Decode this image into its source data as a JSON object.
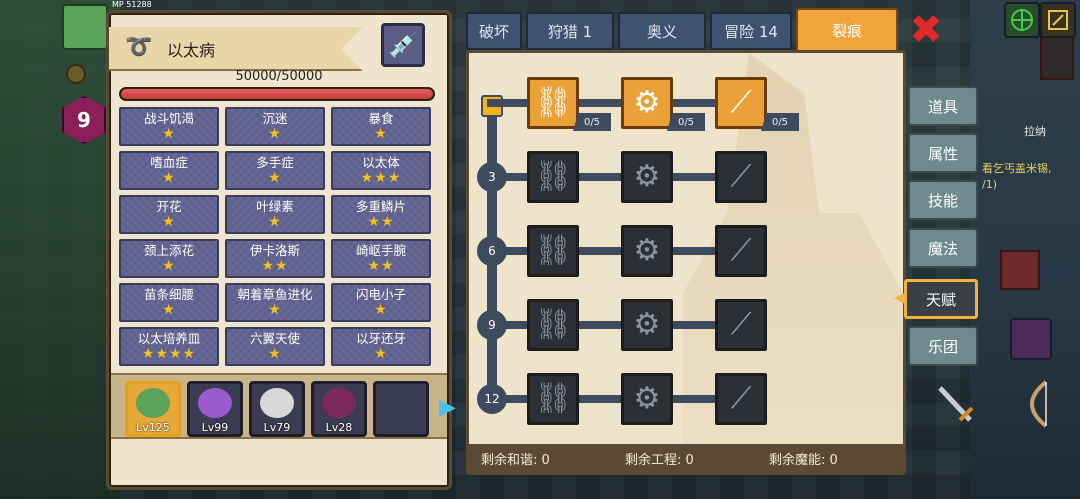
{
  "player": {
    "level": "9",
    "hp_mini": "MP 51288"
  },
  "left_panel": {
    "title": "以太病",
    "hp_text": "50000/50000",
    "hp_fraction": 1.0,
    "traits": [
      {
        "name": "战斗饥渴",
        "stars": 1
      },
      {
        "name": "沉迷",
        "stars": 1
      },
      {
        "name": "暴食",
        "stars": 1
      },
      {
        "name": "嗜血症",
        "stars": 1
      },
      {
        "name": "多手症",
        "stars": 1
      },
      {
        "name": "以太体",
        "stars": 3
      },
      {
        "name": "开花",
        "stars": 1
      },
      {
        "name": "叶绿素",
        "stars": 1
      },
      {
        "name": "多重鳞片",
        "stars": 2
      },
      {
        "name": "颈上添花",
        "stars": 1
      },
      {
        "name": "伊卡洛斯",
        "stars": 2
      },
      {
        "name": "崎岖手腕",
        "stars": 2
      },
      {
        "name": "苗条细腰",
        "stars": 1
      },
      {
        "name": "朝着章鱼进化",
        "stars": 1
      },
      {
        "name": "闪电小子",
        "stars": 1
      },
      {
        "name": "以太培养皿",
        "stars": 4
      },
      {
        "name": "六翼天使",
        "stars": 1
      },
      {
        "name": "以牙还牙",
        "stars": 1
      }
    ],
    "heroes": [
      {
        "level": "Lv125",
        "color": "#5aa35a",
        "selected": true
      },
      {
        "level": "Lv99",
        "color": "#9a5ad0",
        "selected": false
      },
      {
        "level": "Lv79",
        "color": "#d8d8d8",
        "selected": false
      },
      {
        "level": "Lv28",
        "color": "#7a2a5a",
        "selected": false
      },
      {
        "level": "",
        "color": "#3b3b52",
        "selected": false
      }
    ]
  },
  "tabs": [
    {
      "label": "破坏",
      "active": false
    },
    {
      "label": "狩猎 1",
      "active": false
    },
    {
      "label": "奥义",
      "active": false
    },
    {
      "label": "冒险 14",
      "active": false
    },
    {
      "label": "裂痕",
      "active": true
    }
  ],
  "talents": {
    "row_levels": [
      "3",
      "6",
      "9",
      "12"
    ],
    "top_row": [
      {
        "icon": "link-icon",
        "glyph": "⛓",
        "count": "0/5"
      },
      {
        "icon": "gear-icon",
        "glyph": "⚙",
        "count": "0/5"
      },
      {
        "icon": "claw-icon",
        "glyph": "⟋",
        "count": "0/5"
      }
    ],
    "locked_glyphs": [
      "⛓",
      "⚙",
      "⟋"
    ],
    "remaining": {
      "harmony": "剩余和谐: 0",
      "engineering": "剩余工程: 0",
      "magic": "剩余魔能: 0"
    }
  },
  "side_menu": [
    {
      "label": "道具",
      "active": false
    },
    {
      "label": "属性",
      "active": false
    },
    {
      "label": "技能",
      "active": false
    },
    {
      "label": "魔法",
      "active": false
    },
    {
      "label": "天赋",
      "active": true
    },
    {
      "label": "乐团",
      "active": false
    }
  ],
  "world": {
    "npc_name": "拉纳",
    "quest_note": "看乞丐盖米锡,",
    "quest_sub": "/1)"
  },
  "colors": {
    "accent": "#f2a43c",
    "tab": "#3f5370",
    "trait_bg": "#5d5f8c",
    "star": "#f2c21a",
    "close": "#e02a2a"
  }
}
